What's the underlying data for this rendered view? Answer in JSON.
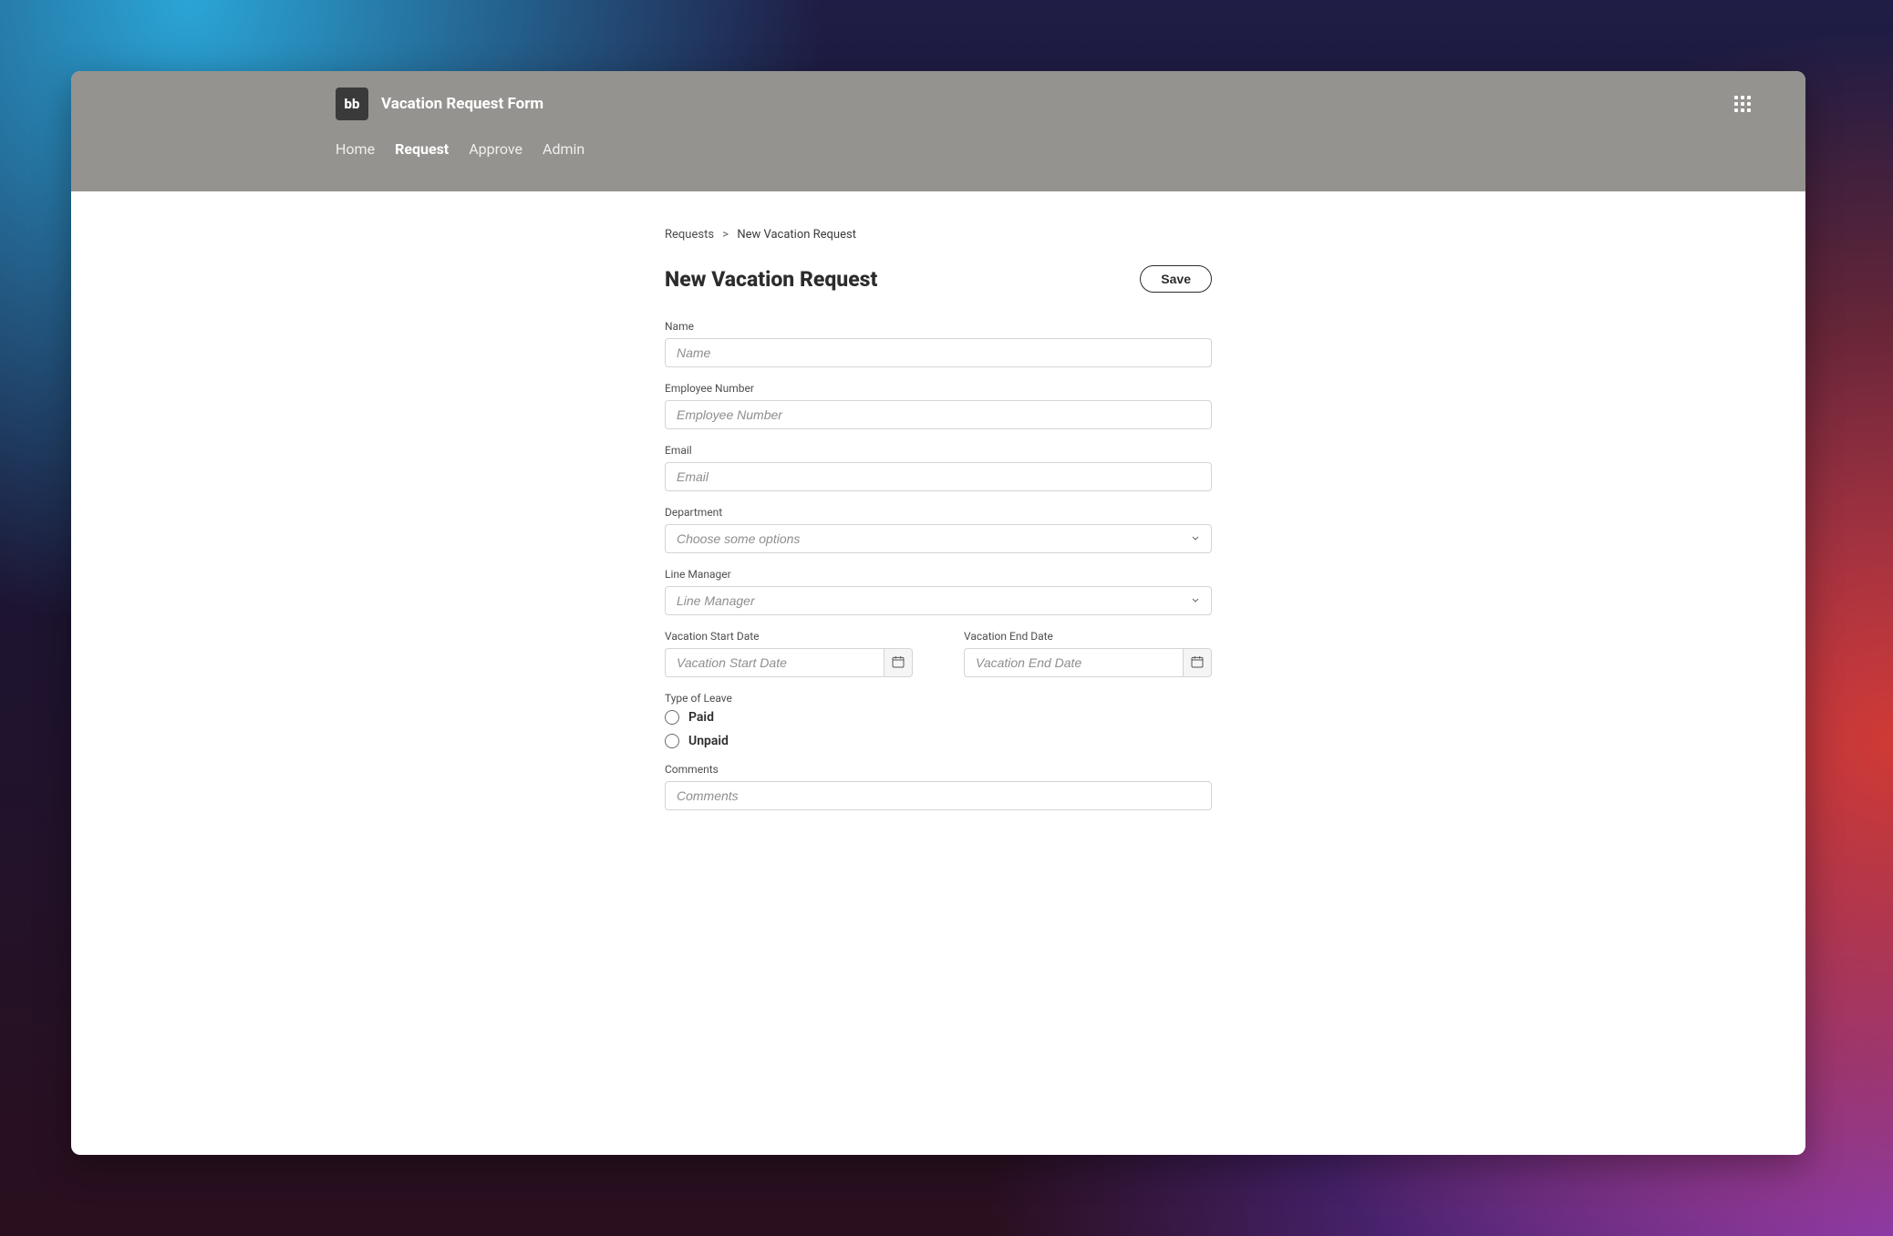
{
  "header": {
    "logo_text": "bb",
    "title": "Vacation Request Form",
    "nav": [
      {
        "label": "Home",
        "active": false
      },
      {
        "label": "Request",
        "active": true
      },
      {
        "label": "Approve",
        "active": false
      },
      {
        "label": "Admin",
        "active": false
      }
    ]
  },
  "breadcrumb": {
    "parent": "Requests",
    "separator": ">",
    "current": "New Vacation Request"
  },
  "page": {
    "title": "New Vacation Request",
    "save_label": "Save"
  },
  "form": {
    "name": {
      "label": "Name",
      "placeholder": "Name",
      "value": ""
    },
    "employee_number": {
      "label": "Employee Number",
      "placeholder": "Employee Number",
      "value": ""
    },
    "email": {
      "label": "Email",
      "placeholder": "Email",
      "value": ""
    },
    "department": {
      "label": "Department",
      "placeholder": "Choose some options",
      "value": ""
    },
    "line_manager": {
      "label": "Line Manager",
      "placeholder": "Line Manager",
      "value": ""
    },
    "start_date": {
      "label": "Vacation Start Date",
      "placeholder": "Vacation Start Date",
      "value": ""
    },
    "end_date": {
      "label": "Vacation End Date",
      "placeholder": "Vacation End Date",
      "value": ""
    },
    "type_of_leave": {
      "label": "Type of Leave",
      "options": [
        "Paid",
        "Unpaid"
      ],
      "value": ""
    },
    "comments": {
      "label": "Comments",
      "placeholder": "Comments",
      "value": ""
    }
  }
}
